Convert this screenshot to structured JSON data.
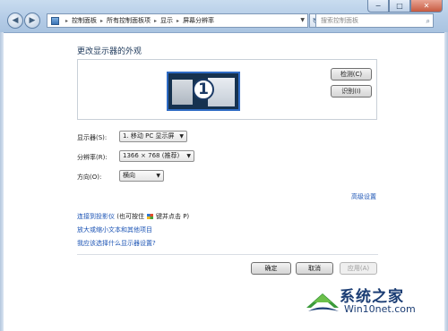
{
  "window": {
    "minimize_glyph": "−",
    "maximize_glyph": "□",
    "close_glyph": "✕"
  },
  "nav": {
    "back_glyph": "◀",
    "forward_glyph": "▶",
    "refresh_glyph": "↻"
  },
  "breadcrumb": {
    "items": [
      "控制面板",
      "所有控制面板项",
      "显示",
      "屏幕分辨率"
    ],
    "separator": "▸"
  },
  "search": {
    "placeholder": "搜索控制面板",
    "icon": "search-icon"
  },
  "main": {
    "title": "更改显示器的外观",
    "monitor_number": "1",
    "detect_label": "检测(C)",
    "identify_label": "识别(I)"
  },
  "settings": {
    "display_label": "显示器(S):",
    "display_value": "1. 移动 PC 显示屏",
    "resolution_label": "分辨率(R):",
    "resolution_value": "1366 × 768 (推荐)",
    "orientation_label": "方向(O):",
    "orientation_value": "横向",
    "advanced_link": "高级设置"
  },
  "links": {
    "projector": "连接到投影仪",
    "projector_hint_prefix": "(也可按住",
    "projector_hint_suffix": "键并点击 P)",
    "text_size": "放大或缩小文本和其他项目",
    "which_settings": "我应该选择什么显示器设置?"
  },
  "footer": {
    "ok_label": "确定",
    "cancel_label": "取消",
    "apply_label": "应用(A)"
  },
  "watermark": {
    "name": "系统之家",
    "url": "Win10net.com"
  },
  "colors": {
    "link": "#1c54b5",
    "title": "#1e395b",
    "monitor_border": "#2f6bc4"
  }
}
